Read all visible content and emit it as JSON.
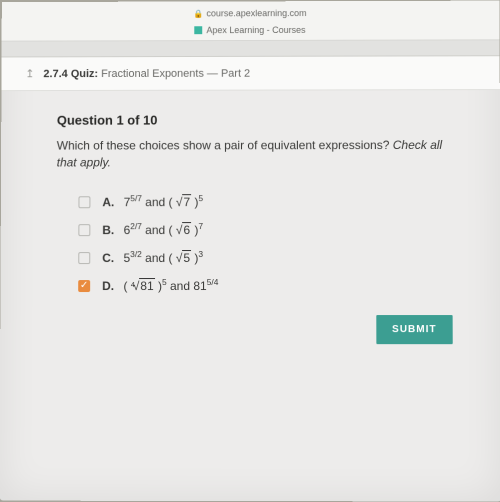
{
  "browser": {
    "url": "course.apexlearning.com",
    "tab_title": "Apex Learning - Courses"
  },
  "breadcrumb": {
    "number": "2.7.4",
    "kind": "Quiz:",
    "title": "Fractional Exponents — Part 2"
  },
  "question": {
    "header": "Question 1 of 10",
    "prompt": "Which of these choices show a pair of equivalent expressions?",
    "hint": "Check all that apply."
  },
  "choices": [
    {
      "letter": "A.",
      "checked": false,
      "lhs_base": "7",
      "lhs_exp": "5/7",
      "root_index": "",
      "radicand": "7",
      "outer_exp": "5"
    },
    {
      "letter": "B.",
      "checked": false,
      "lhs_base": "6",
      "lhs_exp": "2/7",
      "root_index": "",
      "radicand": "6",
      "outer_exp": "7"
    },
    {
      "letter": "C.",
      "checked": false,
      "lhs_base": "5",
      "lhs_exp": "3/2",
      "root_index": "",
      "radicand": "5",
      "outer_exp": "3"
    },
    {
      "letter": "D.",
      "checked": true,
      "root_index": "4",
      "radicand": "81",
      "outer_exp": "5",
      "rhs_base": "81",
      "rhs_exp": "5/4"
    }
  ],
  "submit_label": "SUBMIT"
}
